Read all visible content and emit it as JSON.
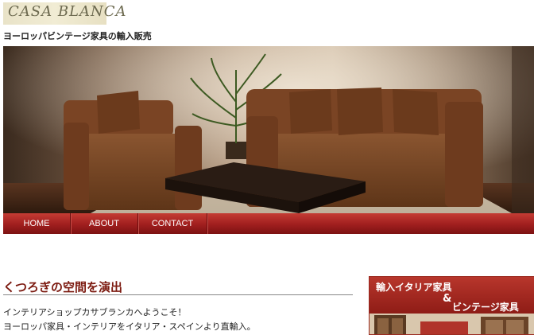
{
  "header": {
    "logo_text": "CASA BLANCA",
    "tagline": "ヨーロッパビンテージ家具の輸入販売"
  },
  "nav": {
    "items": [
      {
        "label": "HOME"
      },
      {
        "label": "ABOUT"
      },
      {
        "label": "CONTACT"
      }
    ]
  },
  "main": {
    "section_title": "くつろぎの空間を演出",
    "intro_lines": [
      "インテリアショップカサブランカへようこそ！",
      "ヨーロッパ家具・インテリアをイタリア・スペインより直輸入。"
    ]
  },
  "banner": {
    "line1": "輸入イタリア家具",
    "amp": "&",
    "line2": "ビンテージ家具"
  },
  "colors": {
    "nav": "#a01e1e",
    "title": "#7c1a10",
    "banner": "#9b2a20"
  }
}
